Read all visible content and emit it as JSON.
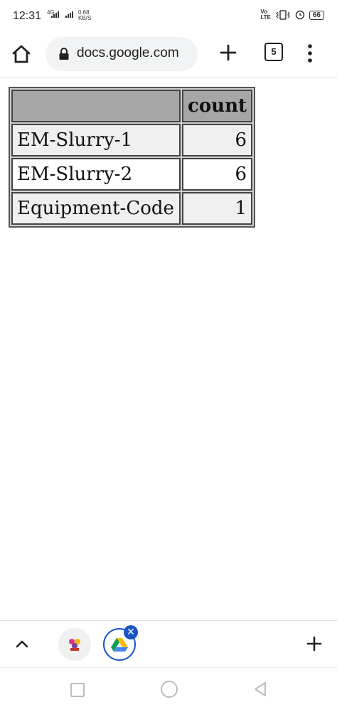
{
  "status": {
    "time": "12:31",
    "network": "4G",
    "speed_value": "0.68",
    "speed_unit": "KB/S",
    "volte_top": "Vo",
    "volte_bottom": "LTE",
    "battery": "66"
  },
  "browser": {
    "url": "docs.google.com",
    "tab_count": "5"
  },
  "table": {
    "header": [
      "",
      "count"
    ],
    "rows": [
      {
        "label": "EM-Slurry-1",
        "count": "6"
      },
      {
        "label": "EM-Slurry-2",
        "count": "6"
      },
      {
        "label": "Equipment-Code",
        "count": "1"
      }
    ]
  },
  "bottom_tabs": {
    "close_symbol": "✕"
  },
  "colors": {
    "accent": "#1a55c4",
    "header_bg": "#a6a6a6"
  }
}
